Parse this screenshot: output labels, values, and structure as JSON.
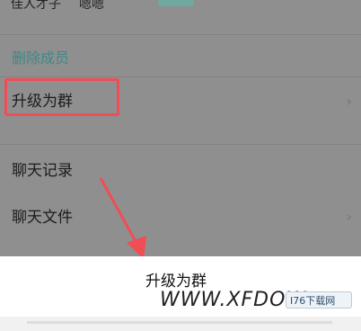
{
  "members": {
    "name1": "佳人才子",
    "name2": "嗯嗯"
  },
  "menu": {
    "remove_member": "删除成员",
    "upgrade_to_group": "升级为群",
    "chat_history": "聊天记录",
    "chat_files": "聊天文件"
  },
  "action_sheet": {
    "title": "升级为群"
  },
  "watermark": {
    "site_text": "WWW.XFDOW",
    "logo_text": "I76下载网"
  },
  "colors": {
    "highlight": "#f04d55",
    "accent": "#3d8a86"
  }
}
